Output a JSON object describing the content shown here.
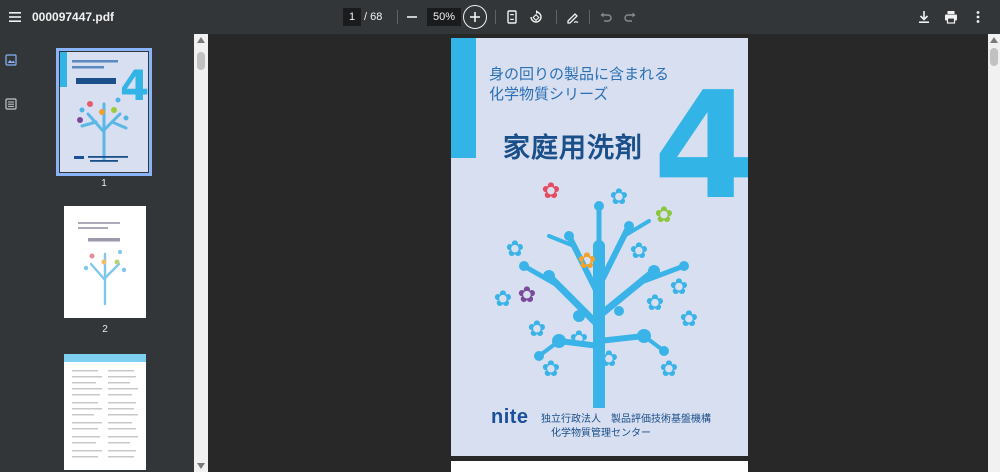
{
  "toolbar": {
    "file_name": "000097447.pdf",
    "current_page": "1",
    "page_total": "/ 68",
    "zoom": "50%"
  },
  "sidebar": {
    "thumbnails": [
      {
        "label": "1"
      },
      {
        "label": "2"
      },
      {
        "label": ""
      }
    ]
  },
  "cover": {
    "subtitle_line1": "身の回りの製品に含まれる",
    "subtitle_line2": "化学物質シリーズ",
    "main_title": "家庭用洗剤",
    "number": "4",
    "logo": "nite",
    "org_line1": "独立行政法人　製品評価技術基盤機構",
    "org_line2": "化学物質管理センター"
  },
  "colors": {
    "toolbar_bg": "#323639",
    "viewer_bg": "#282828",
    "accent_blue": "#32b4e6",
    "title_navy": "#1a4f8a",
    "selection": "#8ab4f8"
  },
  "icons": {
    "menu": "menu-icon",
    "zoom_out": "minus-icon",
    "zoom_in": "plus-icon",
    "fit": "fit-page-icon",
    "rotate": "rotate-icon",
    "annotate": "pen-icon",
    "undo": "undo-icon",
    "redo": "redo-icon",
    "download": "download-icon",
    "print": "print-icon",
    "more": "more-vert-icon",
    "thumbnails": "image-icon",
    "outline": "outline-icon"
  }
}
